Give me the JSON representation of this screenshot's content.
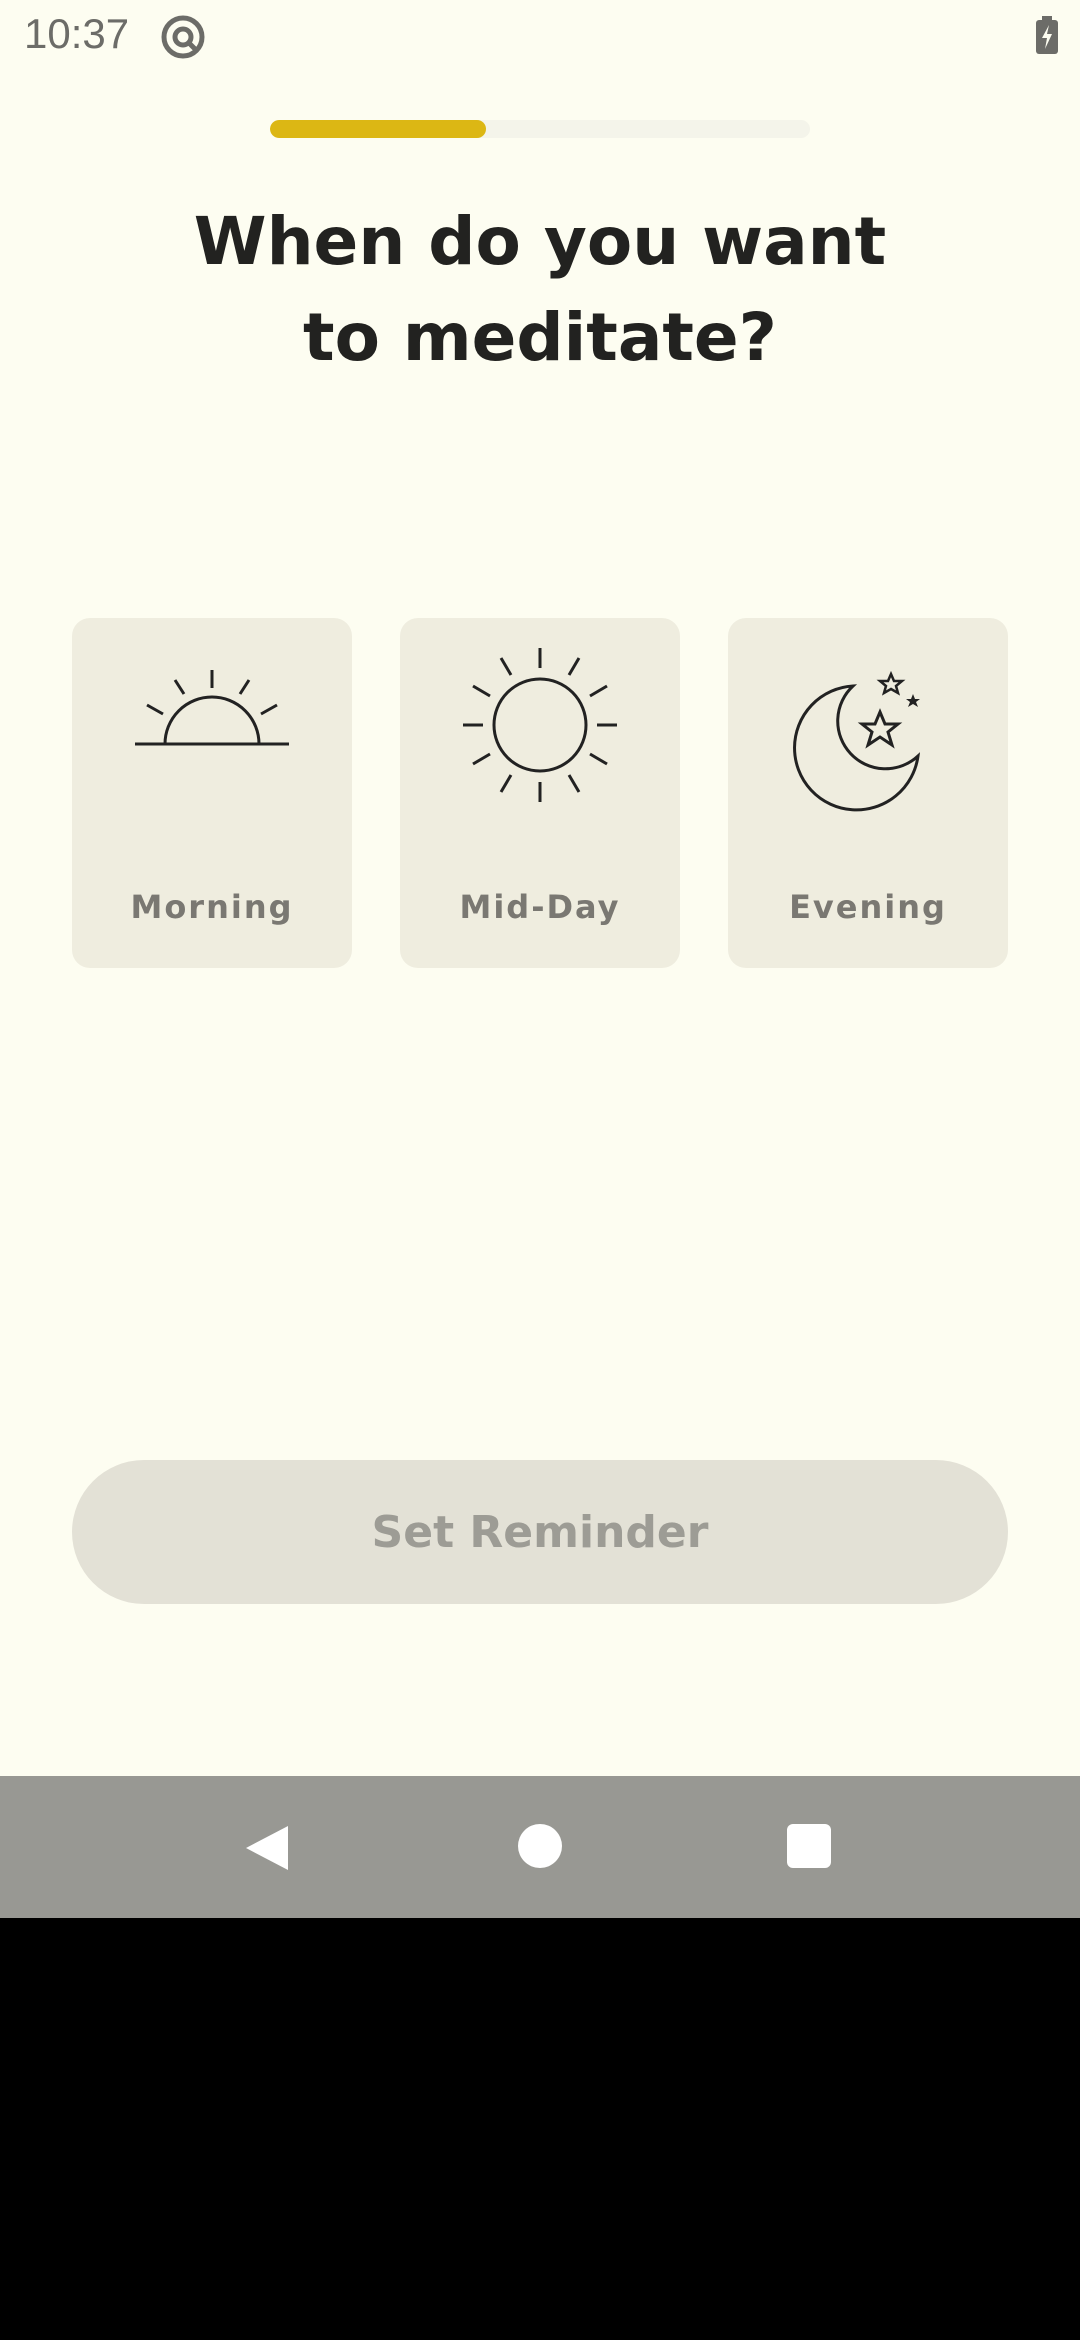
{
  "status": {
    "time": "10:37",
    "icons": [
      "at-sign-icon",
      "battery-charging-icon"
    ]
  },
  "progress": {
    "fraction": 0.4,
    "color": "#dcb714"
  },
  "title": {
    "line1": "When do you want",
    "line2": "to meditate?"
  },
  "options": [
    {
      "label": "Morning",
      "icon": "sunrise-icon"
    },
    {
      "label": "Mid-Day",
      "icon": "sun-icon"
    },
    {
      "label": "Evening",
      "icon": "moon-stars-icon"
    }
  ],
  "cta": {
    "label": "Set Reminder"
  },
  "navbar": {
    "icons": [
      "back-icon",
      "home-icon",
      "recents-icon"
    ]
  }
}
